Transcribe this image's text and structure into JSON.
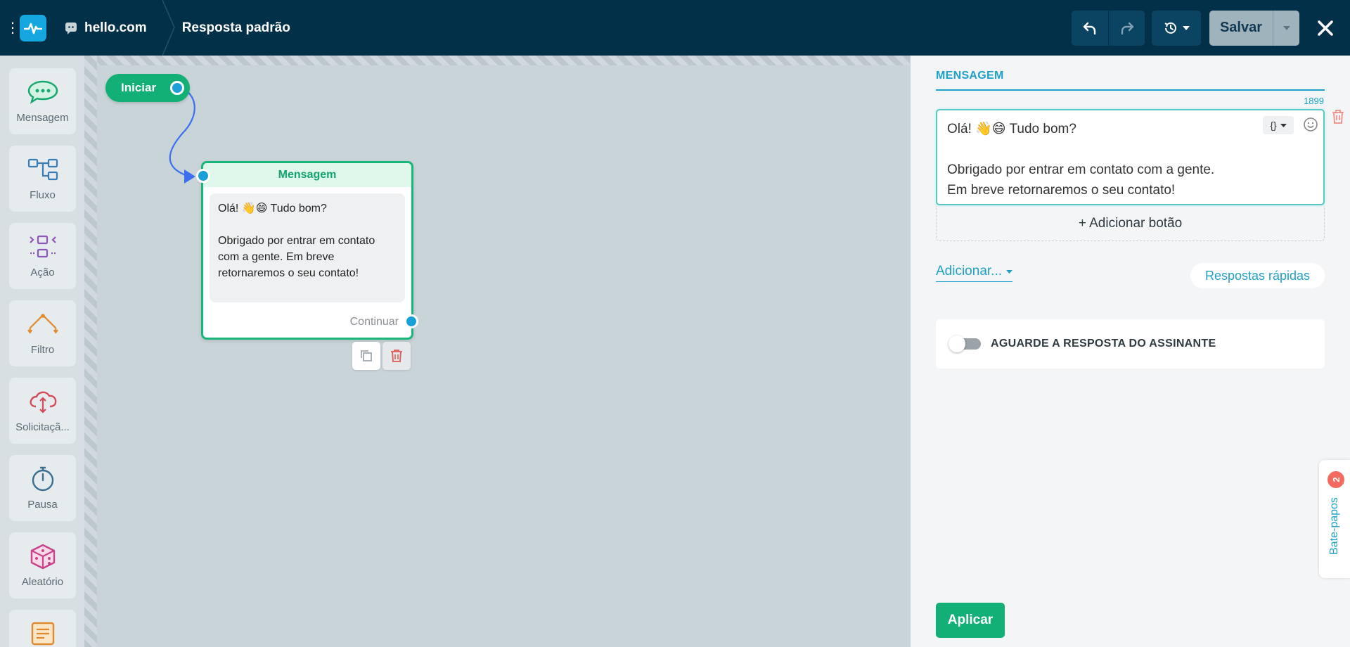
{
  "topbar": {
    "bot_name": "hello.com",
    "page_title": "Resposta padrão",
    "save_label": "Salvar"
  },
  "sidebar": {
    "items": [
      {
        "label": "Mensagem",
        "icon": "chat-bubble-icon"
      },
      {
        "label": "Fluxo",
        "icon": "flow-icon"
      },
      {
        "label": "Ação",
        "icon": "action-icon"
      },
      {
        "label": "Filtro",
        "icon": "filter-icon"
      },
      {
        "label": "Solicitaçã...",
        "icon": "request-cloud-icon"
      },
      {
        "label": "Pausa",
        "icon": "stopwatch-icon"
      },
      {
        "label": "Aleatório",
        "icon": "dice-icon"
      },
      {
        "label": "",
        "icon": "note-icon"
      }
    ]
  },
  "canvas": {
    "start_label": "Iniciar",
    "node": {
      "title": "Mensagem",
      "text": "Olá! 👋😄 Tudo bom?\n\nObrigado por entrar em contato com a gente. Em breve retornaremos o seu contato!",
      "continue_label": "Continuar"
    }
  },
  "panel": {
    "title": "MENSAGEM",
    "char_count": "1899",
    "message_text": "Olá! 👋😄 Tudo bom?\n\nObrigado por entrar em contato com a gente.\nEm breve retornaremos o seu contato!",
    "variable_symbol": "{}",
    "add_button_label": "+ Adicionar botão",
    "add_dropdown_label": "Adicionar...",
    "quick_replies_label": "Respostas rápidas",
    "wait_reply_label": "AGUARDE A RESPOSTA DO ASSINANTE",
    "wait_reply_enabled": false,
    "apply_label": "Aplicar"
  },
  "chats_tab": {
    "label": "Bate-papos",
    "badge": "2"
  },
  "colors": {
    "topbar": "#033049",
    "accent_green": "#12b076",
    "accent_blue": "#1fa0c6",
    "port_blue": "#1aa0d8",
    "danger": "#f36b60"
  }
}
